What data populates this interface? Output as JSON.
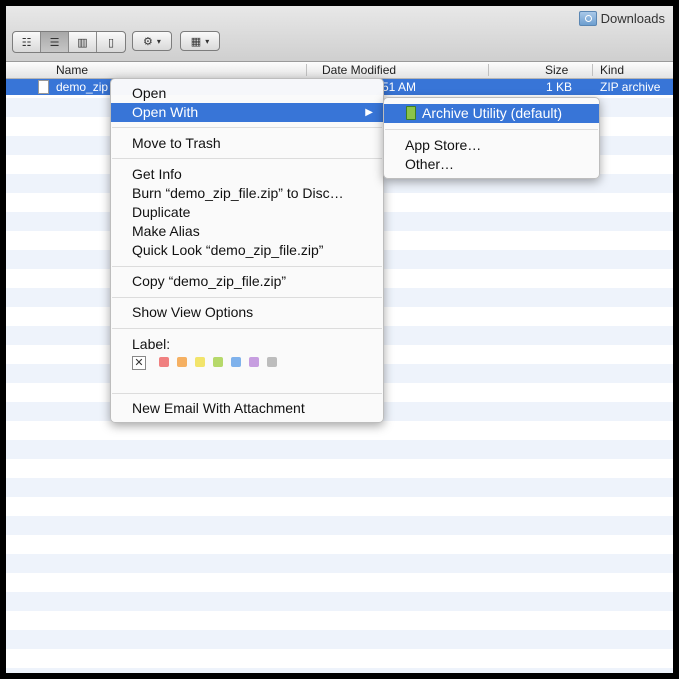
{
  "window": {
    "title": "Downloads",
    "folder_icon": "folder-icon"
  },
  "toolbar": {
    "view_buttons": [
      {
        "name": "icon-view-button",
        "glyph": "☷"
      },
      {
        "name": "list-view-button",
        "glyph": "☰"
      },
      {
        "name": "column-view-button",
        "glyph": "▥"
      },
      {
        "name": "coverflow-view-button",
        "glyph": "▯"
      }
    ],
    "action_glyph": "⚙",
    "arrange_glyph": "▦",
    "caret": "▾"
  },
  "columns": {
    "name": "Name",
    "date_modified": "Date Modified",
    "size": "Size",
    "kind": "Kind"
  },
  "file_row": {
    "name": "demo_zip",
    "date": "51 AM",
    "size": "1 KB",
    "kind": "ZIP archive"
  },
  "context_menu": {
    "open": "Open",
    "open_with": "Open With",
    "submenu_arrow": "▶",
    "move_to_trash": "Move to Trash",
    "get_info": "Get Info",
    "burn": "Burn “demo_zip_file.zip” to Disc…",
    "duplicate": "Duplicate",
    "make_alias": "Make Alias",
    "quick_look": "Quick Look “demo_zip_file.zip”",
    "copy": "Copy “demo_zip_file.zip”",
    "show_view_options": "Show View Options",
    "label": "Label:",
    "label_none": "✕",
    "label_colors": [
      "#f08080",
      "#f5b062",
      "#f2e46b",
      "#b6d96a",
      "#7fb2ec",
      "#c79ee0",
      "#bdbdbd"
    ],
    "new_email": "New Email With Attachment"
  },
  "open_with_submenu": {
    "archive_utility": "Archive Utility (default)",
    "app_store": "App Store…",
    "other": "Other…"
  },
  "colors": {
    "selection": "#3875d7"
  }
}
